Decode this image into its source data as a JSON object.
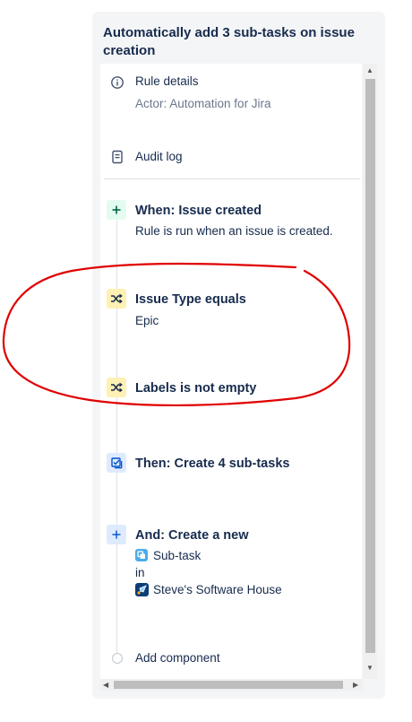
{
  "panel": {
    "title": "Automatically add 3 sub-tasks on issue creation"
  },
  "rule_details": {
    "label": "Rule details",
    "actor": "Actor: Automation for Jira"
  },
  "audit_log": {
    "label": "Audit log"
  },
  "steps": [
    {
      "title": "When: Issue created",
      "description": "Rule is run when an issue is created."
    },
    {
      "title": "Issue Type equals",
      "description": "Epic"
    },
    {
      "title": "Labels is not empty"
    },
    {
      "title": "Then: Create 4 sub-tasks"
    },
    {
      "title": "And: Create a new",
      "issue_type": "Sub-task",
      "in_label": "in",
      "project": "Steve's Software House"
    }
  ],
  "add_component": {
    "label": "Add component"
  },
  "colors": {
    "annotation": "#e00000",
    "trigger": "#e3fcef",
    "condition": "#fff0b3",
    "action": "#deebff"
  },
  "icons": [
    "info-icon",
    "document-icon",
    "plus-icon",
    "shuffle-icon",
    "checkbox-icon",
    "subtask-icon",
    "project-icon"
  ]
}
